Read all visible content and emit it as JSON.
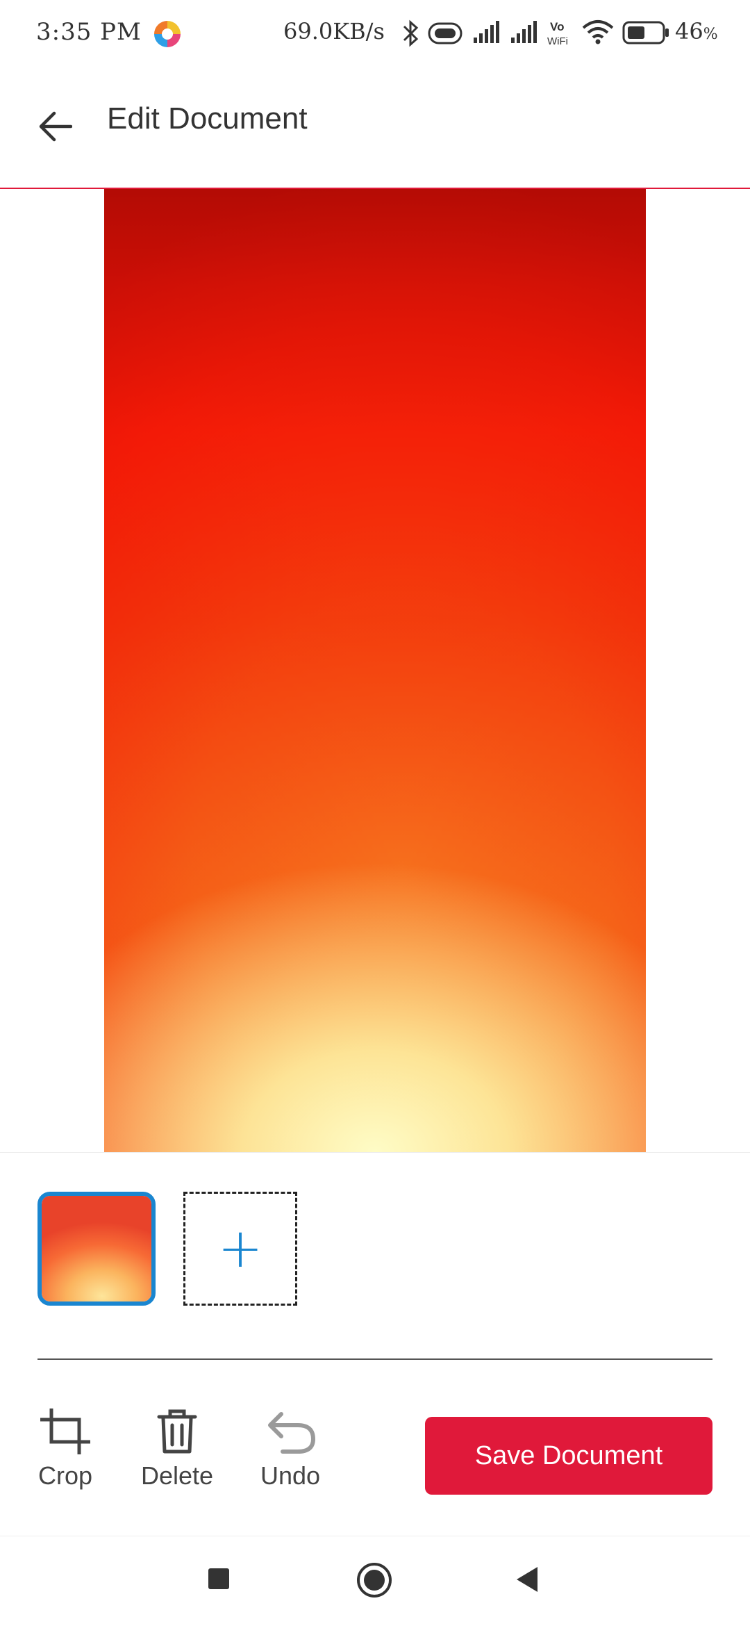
{
  "status_bar": {
    "time": "3:35 PM",
    "net_speed": "69.0KB/s",
    "battery": "46",
    "battery_unit": "%",
    "icons": [
      "app-notification-icon",
      "bluetooth-icon",
      "toggle-icon",
      "signal-icon",
      "signal-icon",
      "vowifi-icon",
      "wifi-icon",
      "battery-icon"
    ]
  },
  "header": {
    "title": "Edit Document",
    "back_icon": "arrow-left-icon"
  },
  "pages": {
    "add_symbol": "+"
  },
  "toolbar": {
    "crop_label": "Crop",
    "delete_label": "Delete",
    "undo_label": "Undo",
    "save_label": "Save Document"
  },
  "colors": {
    "accent": "#e0193a",
    "selection": "#1a86d0"
  },
  "nav_bar": {
    "icons": [
      "recents-square-icon",
      "home-circle-icon",
      "back-triangle-icon"
    ]
  }
}
